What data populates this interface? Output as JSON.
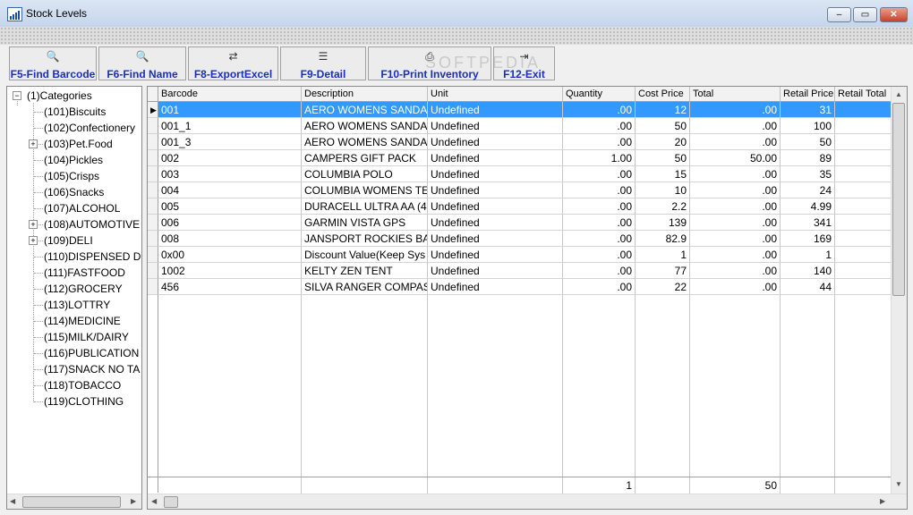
{
  "window": {
    "title": "Stock Levels",
    "buttons": [
      "–",
      "▭",
      "✕"
    ]
  },
  "toolbar": [
    {
      "label": "F5-Find Barcode",
      "icon": "find-document-icon",
      "glyph": "🔍"
    },
    {
      "label": "F6-Find Name",
      "icon": "find-document-icon",
      "glyph": "🔍"
    },
    {
      "label": "F8-ExportExcel",
      "icon": "export-icon",
      "glyph": "⇄"
    },
    {
      "label": "F9-Detail",
      "icon": "detail-icon",
      "glyph": "☰"
    },
    {
      "label": "F10-Print Inventory",
      "icon": "printer-icon",
      "glyph": "⎙"
    },
    {
      "label": "F12-Exit",
      "icon": "exit-door-icon",
      "glyph": "⇥"
    }
  ],
  "tree": {
    "root": "(1)Categories",
    "items": [
      {
        "label": "(101)Biscuits",
        "expandable": false
      },
      {
        "label": "(102)Confectionery",
        "expandable": false
      },
      {
        "label": "(103)Pet.Food",
        "expandable": true
      },
      {
        "label": "(104)Pickles",
        "expandable": false
      },
      {
        "label": "(105)Crisps",
        "expandable": false
      },
      {
        "label": "(106)Snacks",
        "expandable": false
      },
      {
        "label": "(107)ALCOHOL",
        "expandable": false
      },
      {
        "label": "(108)AUTOMOTIVE",
        "expandable": true
      },
      {
        "label": "(109)DELI",
        "expandable": true
      },
      {
        "label": "(110)DISPENSED D",
        "expandable": false
      },
      {
        "label": "(111)FASTFOOD",
        "expandable": false
      },
      {
        "label": "(112)GROCERY",
        "expandable": false
      },
      {
        "label": "(113)LOTTRY",
        "expandable": false
      },
      {
        "label": "(114)MEDICINE",
        "expandable": false
      },
      {
        "label": "(115)MILK/DAIRY",
        "expandable": false
      },
      {
        "label": "(116)PUBLICATION",
        "expandable": false
      },
      {
        "label": "(117)SNACK NO TA",
        "expandable": false
      },
      {
        "label": "(118)TOBACCO",
        "expandable": false
      },
      {
        "label": "(119)CLOTHING",
        "expandable": false
      }
    ]
  },
  "grid": {
    "columns": [
      "Barcode",
      "Description",
      "Unit",
      "Quantity",
      "Cost Price",
      "Total",
      "Retail Price",
      "Retail Total"
    ],
    "rows": [
      [
        "001",
        "AERO WOMENS SANDAL",
        "Undefined",
        ".00",
        "12",
        ".00",
        "31",
        ""
      ],
      [
        "001_1",
        "AERO WOMENS SANDAL",
        "Undefined",
        ".00",
        "50",
        ".00",
        "100",
        ""
      ],
      [
        "001_3",
        "AERO WOMENS SANDAL",
        "Undefined",
        ".00",
        "20",
        ".00",
        "50",
        ""
      ],
      [
        "002",
        "CAMPERS GIFT PACK",
        "Undefined",
        "1.00",
        "50",
        "50.00",
        "89",
        ""
      ],
      [
        "003",
        "COLUMBIA POLO",
        "Undefined",
        ".00",
        "15",
        ".00",
        "35",
        ""
      ],
      [
        "004",
        "COLUMBIA WOMENS TEE",
        "Undefined",
        ".00",
        "10",
        ".00",
        "24",
        ""
      ],
      [
        "005",
        "DURACELL ULTRA AA (4",
        "Undefined",
        ".00",
        "2.2",
        ".00",
        "4.99",
        ""
      ],
      [
        "006",
        "GARMIN VISTA GPS",
        "Undefined",
        ".00",
        "139",
        ".00",
        "341",
        ""
      ],
      [
        "008",
        "JANSPORT ROCKIES BAG",
        "Undefined",
        ".00",
        "82.9",
        ".00",
        "169",
        ""
      ],
      [
        "0x00",
        "Discount Value(Keep Sys",
        "Undefined",
        ".00",
        "1",
        ".00",
        "1",
        ""
      ],
      [
        "1002",
        "KELTY ZEN TENT",
        "Undefined",
        ".00",
        "77",
        ".00",
        "140",
        ""
      ],
      [
        "456",
        "SILVA RANGER COMPASS",
        "Undefined",
        ".00",
        "22",
        ".00",
        "44",
        ""
      ]
    ],
    "selected_row": 0,
    "totals": [
      "",
      "",
      "",
      "1",
      "",
      "50",
      "",
      ""
    ]
  },
  "watermark": "SOFTPEDIA",
  "colors": {
    "selection": "#3399ff",
    "toolbar_text": "#1a2fbf"
  }
}
